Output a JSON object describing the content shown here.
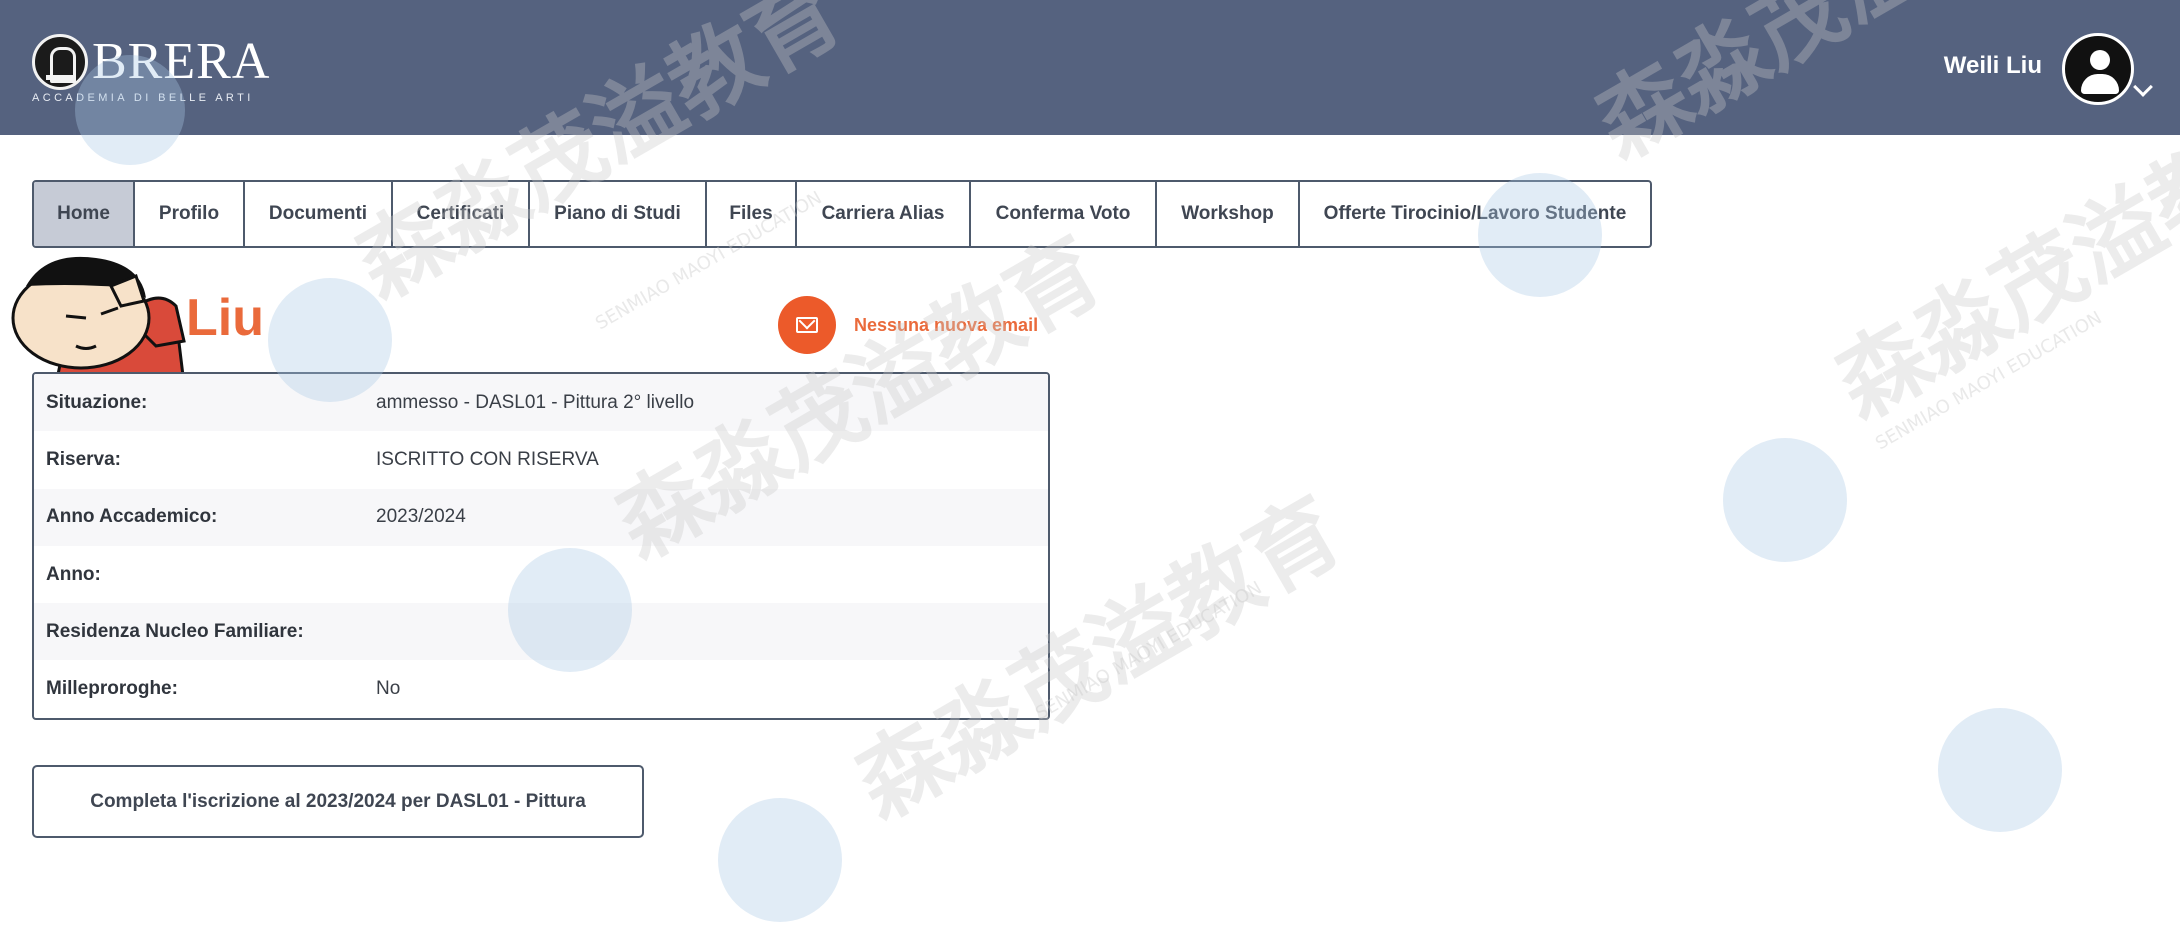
{
  "header": {
    "logo_name": "BRERA",
    "logo_subtitle": "ACCADEMIA DI BELLE ARTI",
    "user_name": "Weili Liu",
    "background_color": "#55627f"
  },
  "tabs": [
    {
      "label": "Home",
      "active": true
    },
    {
      "label": "Profilo",
      "active": false
    },
    {
      "label": "Documenti",
      "active": false
    },
    {
      "label": "Certificati",
      "active": false
    },
    {
      "label": "Piano di Studi",
      "active": false
    },
    {
      "label": "Files",
      "active": false
    },
    {
      "label": "Carriera Alias",
      "active": false
    },
    {
      "label": "Conferma Voto",
      "active": false
    },
    {
      "label": "Workshop",
      "active": false
    },
    {
      "label": "Offerte Tirocinio/Lavoro Studente",
      "active": false
    }
  ],
  "student": {
    "name": "Liu",
    "name_color": "#ea6a3b"
  },
  "email": {
    "label": "Nessuna nuova email",
    "icon": "envelope-icon"
  },
  "info": {
    "rows": [
      {
        "label": "Situazione:",
        "value": "ammesso - DASL01 - Pittura 2° livello"
      },
      {
        "label": "Riserva:",
        "value": "ISCRITTO CON RISERVA"
      },
      {
        "label": "Anno Accademico:",
        "value": "2023/2024"
      },
      {
        "label": "Anno:",
        "value": ""
      },
      {
        "label": "Residenza Nucleo Familiare:",
        "value": ""
      },
      {
        "label": "Milleproroghe:",
        "value": "No"
      }
    ]
  },
  "action": {
    "label": "Completa l'iscrizione al 2023/2024 per DASL01 - Pittura"
  },
  "watermark": {
    "text": "森淼茂溢教育",
    "subtext": "SENMIAO MAOYI EDUCATION"
  }
}
